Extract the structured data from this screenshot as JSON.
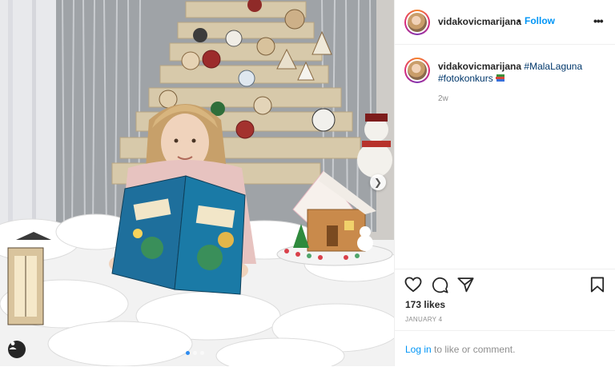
{
  "post": {
    "username": "vidakovicmarijana",
    "bullet": "•",
    "follow_label": "Follow",
    "more_label": "•••",
    "caption": {
      "username": "vidakovicmarijana",
      "hashtags": [
        "#MalaLaguna",
        "#fotokonkurs"
      ],
      "emoji": "books-emoji"
    },
    "time_ago": "2w",
    "likes_text": "173 likes",
    "date": "JANUARY 4",
    "login": {
      "link_label": "Log in",
      "rest_text": " to like or comment."
    },
    "carousel": {
      "current": 1,
      "total": 3
    },
    "icons": {
      "like": "heart-icon",
      "comment": "comment-icon",
      "share": "share-icon",
      "save": "bookmark-icon",
      "next": "chevron-right-icon",
      "tag": "user-tag-icon"
    }
  },
  "colors": {
    "link": "#0095f6",
    "hashtag": "#00376b",
    "muted": "#8e8e8e",
    "carousel_active": "#2f8cf0"
  }
}
